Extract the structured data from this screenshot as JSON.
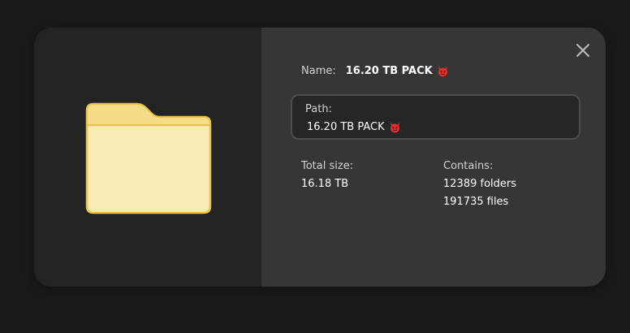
{
  "dialog": {
    "name_label": "Name:",
    "name_value": "16.20 TB PACK",
    "name_emoji": "devil-face-icon",
    "path_label": "Path:",
    "path_value": "16.20 TB PACK",
    "path_emoji": "devil-face-icon",
    "total_size_label": "Total size:",
    "total_size_value": "16.18 TB",
    "contains_label": "Contains:",
    "folders_value": "12389 folders",
    "files_value": "191735 files",
    "close_icon": "close-icon",
    "folder_icon": "folder-icon"
  },
  "colors": {
    "backdrop": "#1a1a1a",
    "left_pane": "#232323",
    "right_pane": "#363636",
    "folder_fill": "#fbebb5",
    "folder_stroke": "#e7c34a",
    "emoji_red": "#e0312e"
  }
}
